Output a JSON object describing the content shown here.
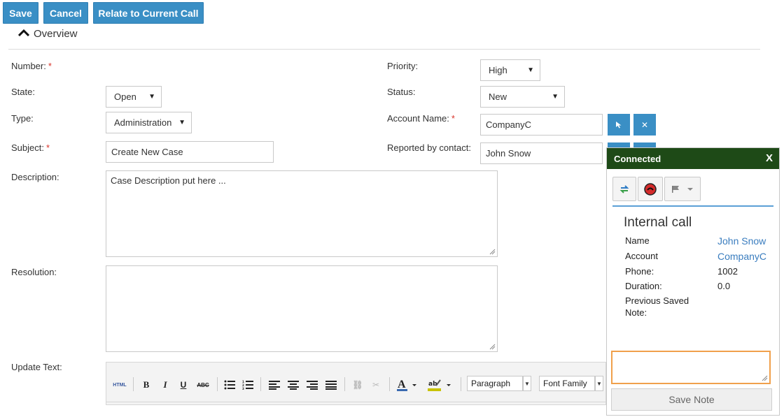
{
  "toolbar": {
    "save_label": "Save",
    "cancel_label": "Cancel",
    "relate_label": "Relate to Current Call"
  },
  "section": {
    "title": "Overview"
  },
  "form": {
    "number_label": "Number:",
    "state_label": "State:",
    "state_value": "Open",
    "type_label": "Type:",
    "type_value": "Administration",
    "subject_label": "Subject:",
    "subject_value": "Create New Case",
    "description_label": "Description:",
    "description_value": "Case Description put here ...",
    "resolution_label": "Resolution:",
    "resolution_value": "",
    "update_text_label": "Update Text:",
    "priority_label": "Priority:",
    "priority_value": "High",
    "status_label": "Status:",
    "status_value": "New",
    "account_name_label": "Account Name:",
    "account_name_value": "CompanyC",
    "reported_by_label": "Reported by contact:",
    "reported_by_value": "John Snow",
    "required_mark": "*"
  },
  "editor": {
    "html_label": "HTML",
    "bold_label": "B",
    "italic_label": "I",
    "underline_label": "U",
    "strike_label": "ABC",
    "format_value": "Paragraph",
    "font_family_value": "Font Family"
  },
  "call_popup": {
    "status": "Connected",
    "close_label": "X",
    "title": "Internal call",
    "name_label": "Name",
    "name_value": "John Snow",
    "account_label": "Account",
    "account_value": "CompanyC",
    "phone_label": "Phone:",
    "phone_value": "1002",
    "duration_label": "Duration:",
    "duration_value": "0.0",
    "previous_note_label_1": "Previous Saved",
    "previous_note_label_2": "Note:",
    "note_value": "",
    "save_note_label": "Save Note"
  },
  "colors": {
    "primary_button": "#3a8fc5",
    "popup_header": "#1e4a17",
    "link": "#3a7dbf",
    "required": "#d9352b",
    "note_focus": "#f0a04b"
  }
}
